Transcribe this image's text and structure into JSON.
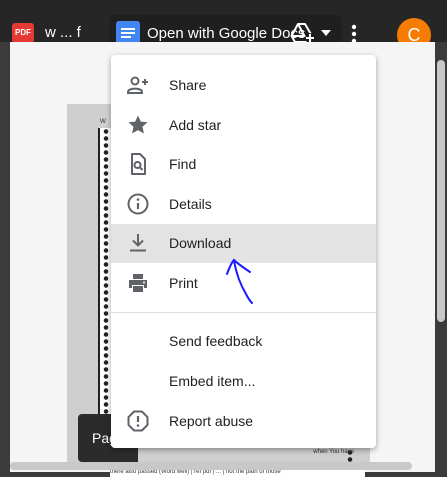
{
  "header": {
    "file_name": "w ... f",
    "file_badge": "PDF",
    "open_with_label": "Open with Google Docs",
    "avatar_letter": "C"
  },
  "viewer": {
    "page_pill": "Pag"
  },
  "menu": {
    "items": [
      {
        "label": "Share",
        "icon": "person-add-icon"
      },
      {
        "label": "Add star",
        "icon": "star-icon"
      },
      {
        "label": "Find",
        "icon": "find-in-page-icon"
      },
      {
        "label": "Details",
        "icon": "info-icon"
      },
      {
        "label": "Download",
        "icon": "download-icon",
        "highlighted": true
      },
      {
        "label": "Print",
        "icon": "print-icon"
      },
      {
        "label": "Send feedback",
        "icon": ""
      },
      {
        "label": "Embed item...",
        "icon": ""
      },
      {
        "label": "Report abuse",
        "icon": "report-icon"
      }
    ]
  },
  "colors": {
    "avatar": "#f57c00",
    "docs_blue": "#4285f4",
    "pdf_red": "#e53935",
    "annotation_ink": "#1a1aff",
    "menu_hover": "#e3e3e3"
  }
}
